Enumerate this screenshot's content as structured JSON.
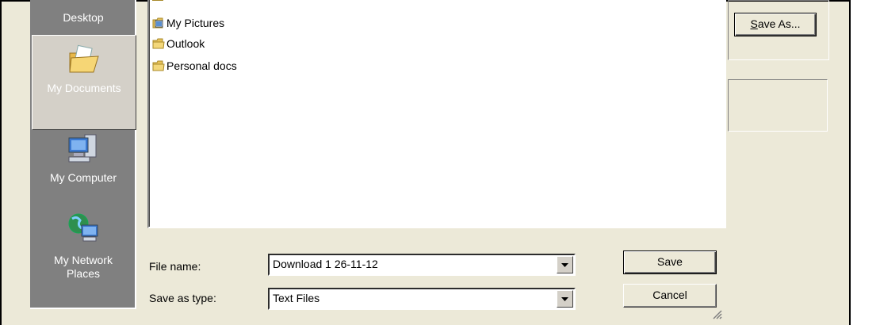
{
  "places": [
    {
      "id": "desktop",
      "label": "Desktop",
      "selected": false
    },
    {
      "id": "mydocuments",
      "label": "My Documents",
      "selected": true
    },
    {
      "id": "mycomputer",
      "label": "My Computer",
      "selected": false
    },
    {
      "id": "mynetwork",
      "label": "My Network Places",
      "line1": "My Network",
      "line2": "Places",
      "selected": false
    }
  ],
  "files": [
    {
      "name": "My Pictures",
      "icon": "pictures-folder-icon"
    },
    {
      "name": "Outlook",
      "icon": "folder-icon"
    },
    {
      "name": "Personal docs",
      "icon": "folder-icon"
    }
  ],
  "form": {
    "file_name_label": "File name:",
    "file_name_value": "Download 1 26-11-12",
    "save_type_label": "Save as type:",
    "save_type_value": "Text Files"
  },
  "buttons": {
    "save": "Save",
    "cancel": "Cancel",
    "save_as_rest": "ave As...",
    "save_as_mnemonic": "S"
  }
}
